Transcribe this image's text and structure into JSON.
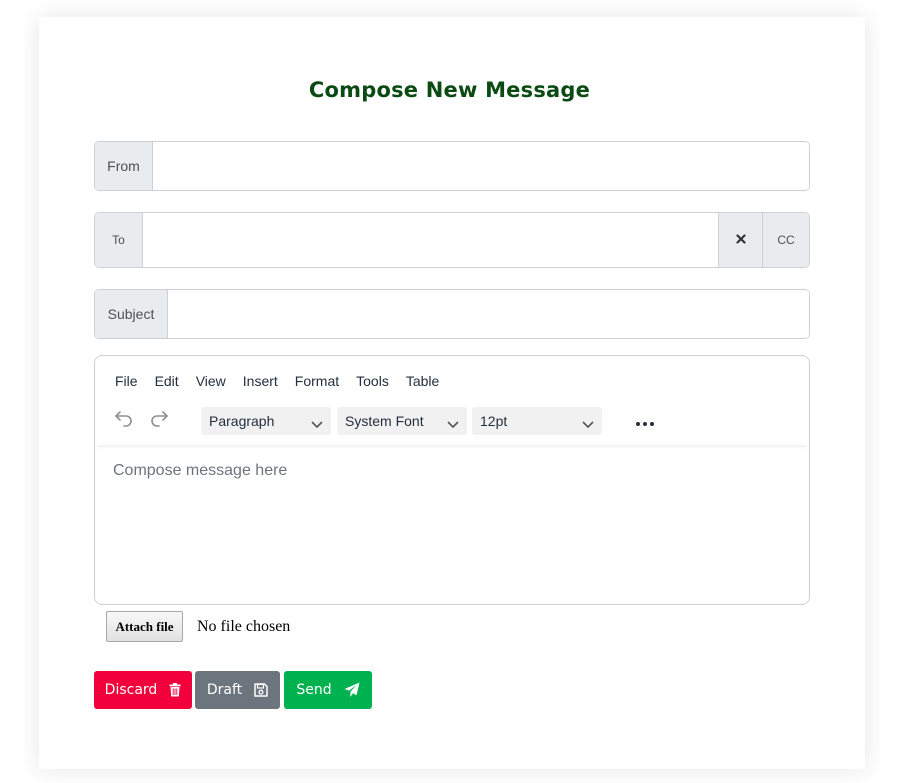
{
  "form": {
    "title": "Compose New Message",
    "from": {
      "label": "From",
      "value": "",
      "placeholder": ""
    },
    "to": {
      "label": "To",
      "value": "",
      "placeholder": "",
      "cc_label": "CC"
    },
    "subject": {
      "label": "Subject",
      "value": "",
      "placeholder": ""
    }
  },
  "editor": {
    "menu": [
      "File",
      "Edit",
      "View",
      "Insert",
      "Format",
      "Tools",
      "Table"
    ],
    "block_format": "Paragraph",
    "font_family": "System Font",
    "font_size": "12pt",
    "placeholder": "Compose message here",
    "icons": [
      "undo-icon",
      "redo-icon",
      "more-icon"
    ]
  },
  "attachment": {
    "button_label": "Attach file",
    "status": "No file chosen"
  },
  "actions": {
    "discard": {
      "label": "Discard",
      "icon": "trash-icon",
      "color": "#f2003c"
    },
    "draft": {
      "label": "Draft",
      "icon": "save-icon",
      "color": "#6c757d"
    },
    "send": {
      "label": "Send",
      "icon": "paper-plane-icon",
      "color": "#00b14f"
    }
  },
  "colors": {
    "title": "#0b4a12",
    "addon_bg": "#e9ecef",
    "border": "#cdd1d6"
  }
}
